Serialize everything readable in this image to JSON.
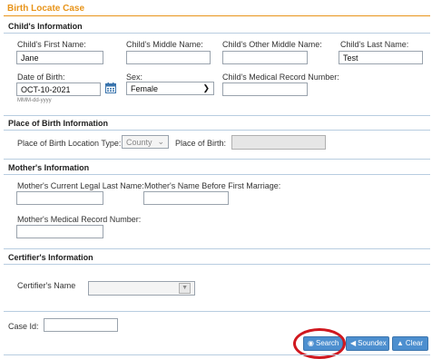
{
  "page": {
    "title": "Birth Locate Case"
  },
  "child": {
    "section_title": "Child's Information",
    "first_name_label": "Child's First Name:",
    "first_name_value": "Jane",
    "middle_name_label": "Child's Middle Name:",
    "middle_name_value": "",
    "other_middle_label": "Child's Other Middle Name:",
    "other_middle_value": "",
    "last_name_label": "Child's Last Name:",
    "last_name_value": "Test",
    "dob_label": "Date of Birth:",
    "dob_value": "OCT-10-2021",
    "dob_hint": "MMM-dd-yyyy",
    "sex_label": "Sex:",
    "sex_value": "Female",
    "mrn_label": "Child's Medical Record Number:",
    "mrn_value": ""
  },
  "place": {
    "section_title": "Place of Birth Information",
    "location_type_label": "Place of Birth Location Type:",
    "location_type_value": "County",
    "place_label": "Place of Birth:",
    "place_value": ""
  },
  "mother": {
    "section_title": "Mother's Information",
    "legal_last_label": "Mother's Current Legal Last Name:",
    "legal_last_value": "",
    "before_marriage_label": "Mother's Name Before First Marriage:",
    "before_marriage_value": "",
    "mrn_label": "Mother's Medical Record Number:",
    "mrn_value": ""
  },
  "certifier": {
    "section_title": "Certifier's Information",
    "name_label": "Certifier's Name",
    "name_value": ""
  },
  "case": {
    "id_label": "Case Id:",
    "id_value": ""
  },
  "buttons": {
    "search": "Search",
    "soundex": "Soundex",
    "clear": "Clear"
  },
  "colors": {
    "title": "#e8941a",
    "button": "#4d8fcf",
    "highlight": "#d0181f"
  }
}
